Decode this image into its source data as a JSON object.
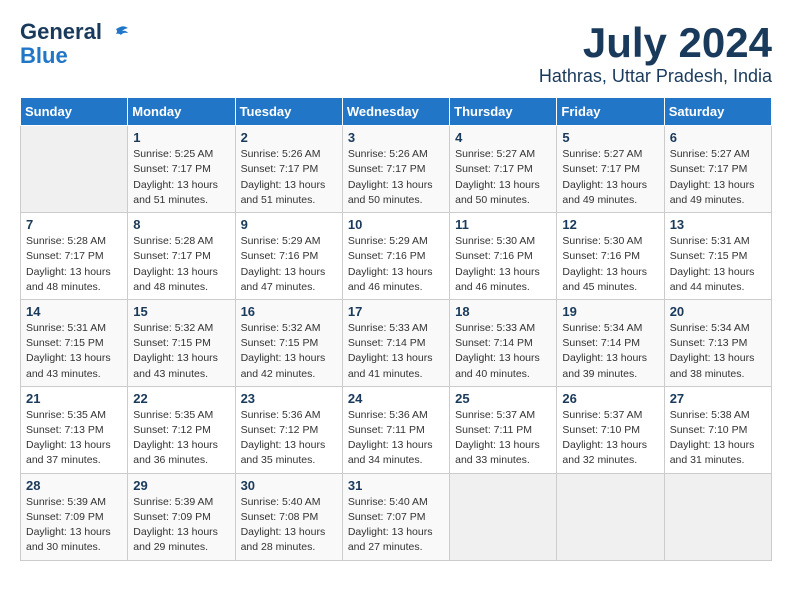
{
  "header": {
    "logo_line1": "General",
    "logo_line2": "Blue",
    "month_title": "July 2024",
    "location": "Hathras, Uttar Pradesh, India"
  },
  "columns": [
    "Sunday",
    "Monday",
    "Tuesday",
    "Wednesday",
    "Thursday",
    "Friday",
    "Saturday"
  ],
  "weeks": [
    [
      {
        "day": "",
        "sunrise": "",
        "sunset": "",
        "daylight": ""
      },
      {
        "day": "1",
        "sunrise": "Sunrise: 5:25 AM",
        "sunset": "Sunset: 7:17 PM",
        "daylight": "Daylight: 13 hours and 51 minutes."
      },
      {
        "day": "2",
        "sunrise": "Sunrise: 5:26 AM",
        "sunset": "Sunset: 7:17 PM",
        "daylight": "Daylight: 13 hours and 51 minutes."
      },
      {
        "day": "3",
        "sunrise": "Sunrise: 5:26 AM",
        "sunset": "Sunset: 7:17 PM",
        "daylight": "Daylight: 13 hours and 50 minutes."
      },
      {
        "day": "4",
        "sunrise": "Sunrise: 5:27 AM",
        "sunset": "Sunset: 7:17 PM",
        "daylight": "Daylight: 13 hours and 50 minutes."
      },
      {
        "day": "5",
        "sunrise": "Sunrise: 5:27 AM",
        "sunset": "Sunset: 7:17 PM",
        "daylight": "Daylight: 13 hours and 49 minutes."
      },
      {
        "day": "6",
        "sunrise": "Sunrise: 5:27 AM",
        "sunset": "Sunset: 7:17 PM",
        "daylight": "Daylight: 13 hours and 49 minutes."
      }
    ],
    [
      {
        "day": "7",
        "sunrise": "Sunrise: 5:28 AM",
        "sunset": "Sunset: 7:17 PM",
        "daylight": "Daylight: 13 hours and 48 minutes."
      },
      {
        "day": "8",
        "sunrise": "Sunrise: 5:28 AM",
        "sunset": "Sunset: 7:17 PM",
        "daylight": "Daylight: 13 hours and 48 minutes."
      },
      {
        "day": "9",
        "sunrise": "Sunrise: 5:29 AM",
        "sunset": "Sunset: 7:16 PM",
        "daylight": "Daylight: 13 hours and 47 minutes."
      },
      {
        "day": "10",
        "sunrise": "Sunrise: 5:29 AM",
        "sunset": "Sunset: 7:16 PM",
        "daylight": "Daylight: 13 hours and 46 minutes."
      },
      {
        "day": "11",
        "sunrise": "Sunrise: 5:30 AM",
        "sunset": "Sunset: 7:16 PM",
        "daylight": "Daylight: 13 hours and 46 minutes."
      },
      {
        "day": "12",
        "sunrise": "Sunrise: 5:30 AM",
        "sunset": "Sunset: 7:16 PM",
        "daylight": "Daylight: 13 hours and 45 minutes."
      },
      {
        "day": "13",
        "sunrise": "Sunrise: 5:31 AM",
        "sunset": "Sunset: 7:15 PM",
        "daylight": "Daylight: 13 hours and 44 minutes."
      }
    ],
    [
      {
        "day": "14",
        "sunrise": "Sunrise: 5:31 AM",
        "sunset": "Sunset: 7:15 PM",
        "daylight": "Daylight: 13 hours and 43 minutes."
      },
      {
        "day": "15",
        "sunrise": "Sunrise: 5:32 AM",
        "sunset": "Sunset: 7:15 PM",
        "daylight": "Daylight: 13 hours and 43 minutes."
      },
      {
        "day": "16",
        "sunrise": "Sunrise: 5:32 AM",
        "sunset": "Sunset: 7:15 PM",
        "daylight": "Daylight: 13 hours and 42 minutes."
      },
      {
        "day": "17",
        "sunrise": "Sunrise: 5:33 AM",
        "sunset": "Sunset: 7:14 PM",
        "daylight": "Daylight: 13 hours and 41 minutes."
      },
      {
        "day": "18",
        "sunrise": "Sunrise: 5:33 AM",
        "sunset": "Sunset: 7:14 PM",
        "daylight": "Daylight: 13 hours and 40 minutes."
      },
      {
        "day": "19",
        "sunrise": "Sunrise: 5:34 AM",
        "sunset": "Sunset: 7:14 PM",
        "daylight": "Daylight: 13 hours and 39 minutes."
      },
      {
        "day": "20",
        "sunrise": "Sunrise: 5:34 AM",
        "sunset": "Sunset: 7:13 PM",
        "daylight": "Daylight: 13 hours and 38 minutes."
      }
    ],
    [
      {
        "day": "21",
        "sunrise": "Sunrise: 5:35 AM",
        "sunset": "Sunset: 7:13 PM",
        "daylight": "Daylight: 13 hours and 37 minutes."
      },
      {
        "day": "22",
        "sunrise": "Sunrise: 5:35 AM",
        "sunset": "Sunset: 7:12 PM",
        "daylight": "Daylight: 13 hours and 36 minutes."
      },
      {
        "day": "23",
        "sunrise": "Sunrise: 5:36 AM",
        "sunset": "Sunset: 7:12 PM",
        "daylight": "Daylight: 13 hours and 35 minutes."
      },
      {
        "day": "24",
        "sunrise": "Sunrise: 5:36 AM",
        "sunset": "Sunset: 7:11 PM",
        "daylight": "Daylight: 13 hours and 34 minutes."
      },
      {
        "day": "25",
        "sunrise": "Sunrise: 5:37 AM",
        "sunset": "Sunset: 7:11 PM",
        "daylight": "Daylight: 13 hours and 33 minutes."
      },
      {
        "day": "26",
        "sunrise": "Sunrise: 5:37 AM",
        "sunset": "Sunset: 7:10 PM",
        "daylight": "Daylight: 13 hours and 32 minutes."
      },
      {
        "day": "27",
        "sunrise": "Sunrise: 5:38 AM",
        "sunset": "Sunset: 7:10 PM",
        "daylight": "Daylight: 13 hours and 31 minutes."
      }
    ],
    [
      {
        "day": "28",
        "sunrise": "Sunrise: 5:39 AM",
        "sunset": "Sunset: 7:09 PM",
        "daylight": "Daylight: 13 hours and 30 minutes."
      },
      {
        "day": "29",
        "sunrise": "Sunrise: 5:39 AM",
        "sunset": "Sunset: 7:09 PM",
        "daylight": "Daylight: 13 hours and 29 minutes."
      },
      {
        "day": "30",
        "sunrise": "Sunrise: 5:40 AM",
        "sunset": "Sunset: 7:08 PM",
        "daylight": "Daylight: 13 hours and 28 minutes."
      },
      {
        "day": "31",
        "sunrise": "Sunrise: 5:40 AM",
        "sunset": "Sunset: 7:07 PM",
        "daylight": "Daylight: 13 hours and 27 minutes."
      },
      {
        "day": "",
        "sunrise": "",
        "sunset": "",
        "daylight": ""
      },
      {
        "day": "",
        "sunrise": "",
        "sunset": "",
        "daylight": ""
      },
      {
        "day": "",
        "sunrise": "",
        "sunset": "",
        "daylight": ""
      }
    ]
  ]
}
